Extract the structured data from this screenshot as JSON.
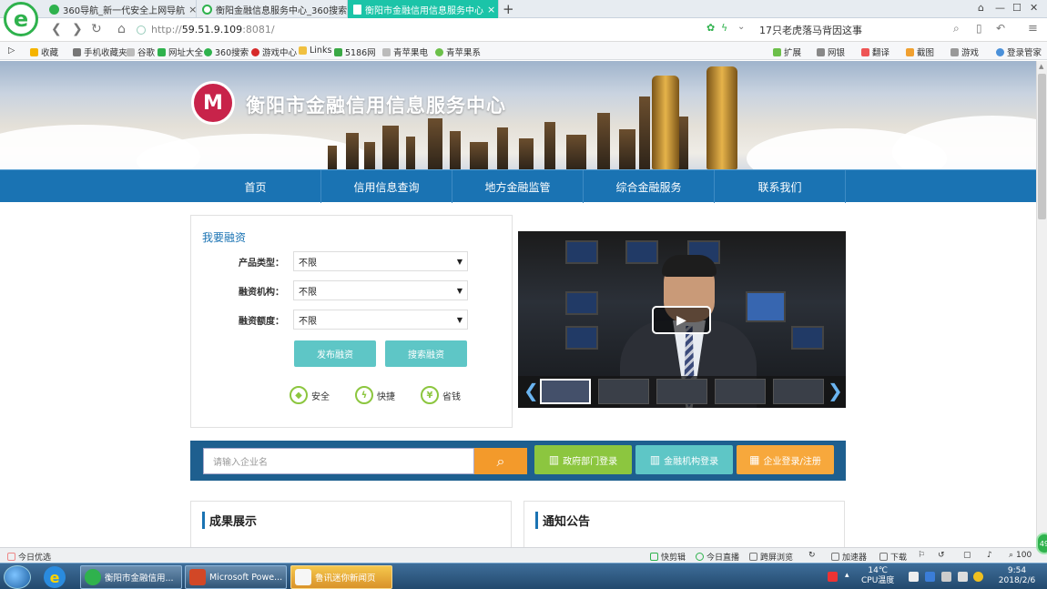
{
  "browser": {
    "tabs": [
      {
        "title": "360导航_新一代安全上网导航",
        "icon_color": "#2fb24d",
        "active": false
      },
      {
        "title": "衡阳金融信息服务中心_360搜索",
        "icon_color": "#2fb24d",
        "active": false
      },
      {
        "title": "衡阳市金融信用信息服务中心",
        "icon_color": "#ffffff",
        "active": true
      }
    ],
    "new_tab_label": "+",
    "close_glyph": "×",
    "window_controls": [
      "⌂",
      "—",
      "☐",
      "✕"
    ],
    "url": {
      "protocol": "http://",
      "host": "59.51.9.109",
      "rest": ":8081/"
    },
    "search_text": "17只老虎落马背因这事",
    "accent": "#1bc4a8"
  },
  "bookmarks": [
    {
      "label": "收藏",
      "icon": "star-icon",
      "color": "#f5b400"
    },
    {
      "label": "手机收藏夹",
      "icon": "phone-icon",
      "color": "#777777"
    },
    {
      "label": "谷歌",
      "icon": "page-icon",
      "color": "#bbbbbb"
    },
    {
      "label": "网址大全",
      "icon": "globe-icon",
      "color": "#2fb24d"
    },
    {
      "label": "360搜索",
      "icon": "search-icon",
      "color": "#2fb24d"
    },
    {
      "label": "游戏中心",
      "icon": "game-icon",
      "color": "#d62a2a"
    },
    {
      "label": "Links",
      "icon": "folder-icon",
      "color": "#f0c040"
    },
    {
      "label": "5186网",
      "icon": "site-icon",
      "color": "#3aa845"
    },
    {
      "label": "青苹果电",
      "icon": "page-icon",
      "color": "#bbbbbb"
    },
    {
      "label": "青苹果系",
      "icon": "apple-icon",
      "color": "#6cc04a"
    }
  ],
  "bookmark_tools": [
    "扩展",
    "网银",
    "翻译",
    "截图",
    "游戏",
    "登录管家"
  ],
  "site": {
    "logo_glyph": "M",
    "title": "衡阳市金融信用信息服务中心",
    "brand_color": "#1a73b3",
    "nav": [
      "首页",
      "信用信息查询",
      "地方金融监管",
      "综合金融服务",
      "联系我们"
    ]
  },
  "finance_form": {
    "title": "我要融资",
    "fields": [
      {
        "label": "产品类型：",
        "value": "不限"
      },
      {
        "label": "融资机构：",
        "value": "不限"
      },
      {
        "label": "融资额度：",
        "value": "不限"
      }
    ],
    "dropdown_glyph": "▼",
    "publish_button": "发布融资",
    "search_button": "搜索融资",
    "features": [
      {
        "label": "安全",
        "icon": "shield-icon",
        "glyph": "◆"
      },
      {
        "label": "快捷",
        "icon": "lightning-icon",
        "glyph": "ϟ"
      },
      {
        "label": "省钱",
        "icon": "money-icon",
        "glyph": "¥"
      }
    ]
  },
  "video": {
    "play_glyph": "▶",
    "prev_glyph": "❮",
    "next_glyph": "❯",
    "thumb_count": 5
  },
  "company_search": {
    "placeholder": "请输入企业名",
    "search_glyph": "⌕",
    "buttons": [
      {
        "label": "政府部门登录",
        "icon": "government-icon",
        "glyph": "▥",
        "color": "#8cc63f"
      },
      {
        "label": "金融机构登录",
        "icon": "bank-icon",
        "glyph": "▥",
        "color": "#5ec6c6"
      },
      {
        "label": "企业登录/注册",
        "icon": "building-icon",
        "glyph": "▦",
        "color": "#f7a83c"
      }
    ]
  },
  "panels": {
    "achievements": "成果展示",
    "notices": "通知公告"
  },
  "statusbar": {
    "left": "今日优选",
    "items": [
      "快剪辑",
      "今日直播",
      "跨屏浏览",
      "加速器",
      "下载"
    ],
    "zoom": "100",
    "float_ball": "49"
  },
  "taskbar": {
    "tasks": [
      {
        "label": "衡阳市金融信用...",
        "icon_color": "#2fb24d"
      },
      {
        "label": "Microsoft Powe...",
        "icon_color": "#d24726"
      },
      {
        "label": "鲁讯迷你新闻页",
        "icon_color": "#f6f6f6"
      }
    ],
    "tray_temp": "14℃",
    "tray_cpu": "CPU温度",
    "time": "9:54",
    "date": "2018/2/6"
  }
}
